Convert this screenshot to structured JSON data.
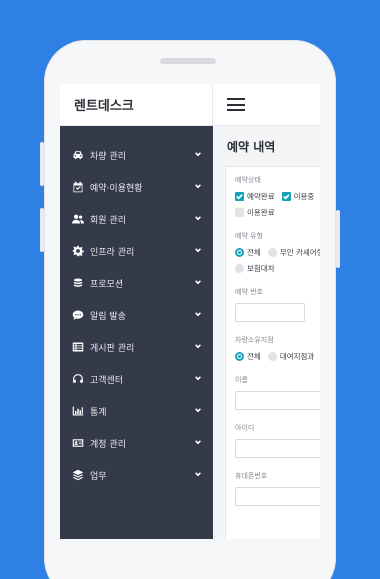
{
  "brand": {
    "title": "렌트데스크"
  },
  "sidebar": {
    "items": [
      {
        "label": "차량 관리",
        "icon": "car-icon"
      },
      {
        "label": "예약·이용현황",
        "icon": "calendar-check-icon"
      },
      {
        "label": "회원 관리",
        "icon": "users-icon"
      },
      {
        "label": "인프라 관리",
        "icon": "gear-icon"
      },
      {
        "label": "프로모션",
        "icon": "coins-icon"
      },
      {
        "label": "알림 발송",
        "icon": "chat-icon"
      },
      {
        "label": "게시판 관리",
        "icon": "list-icon"
      },
      {
        "label": "고객센터",
        "icon": "headset-icon"
      },
      {
        "label": "통계",
        "icon": "bar-chart-icon"
      },
      {
        "label": "계정 관리",
        "icon": "id-card-icon"
      },
      {
        "label": "업무",
        "icon": "layers-icon"
      }
    ]
  },
  "main": {
    "title": "예약 내역",
    "form": {
      "status": {
        "label": "예약상태",
        "options": [
          {
            "label": "예약완료",
            "checked": true
          },
          {
            "label": "이용중",
            "checked": true
          },
          {
            "label": "이용완료",
            "checked": false
          }
        ]
      },
      "reservation_type": {
        "label": "예약 유형",
        "options": [
          {
            "label": "전체",
            "selected": true
          },
          {
            "label": "무인 카셰어링",
            "selected": false
          },
          {
            "label": "보험대차",
            "selected": false
          }
        ]
      },
      "reservation_no": {
        "label": "예약 번호",
        "value": ""
      },
      "vehicle_owner": {
        "label": "차량소유지점",
        "options": [
          {
            "label": "전체",
            "selected": true
          },
          {
            "label": "대여지점과",
            "selected": false
          }
        ]
      },
      "name": {
        "label": "이름",
        "value": ""
      },
      "user_id": {
        "label": "아이디",
        "value": ""
      },
      "phone": {
        "label": "휴대폰번호",
        "value": ""
      }
    }
  },
  "colors": {
    "background": "#2f80e4",
    "sidebar": "#343a4a",
    "accent": "#17a2b8"
  }
}
